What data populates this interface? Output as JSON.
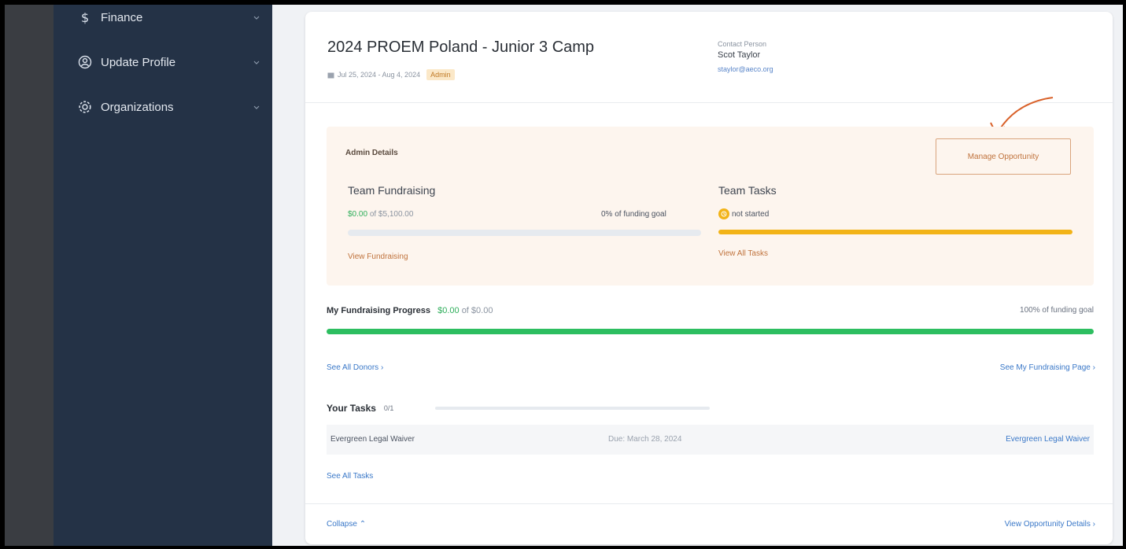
{
  "sidebar": {
    "items": [
      {
        "icon": "dollar-icon",
        "label": "Finance"
      },
      {
        "icon": "user-circle-icon",
        "label": "Update Profile"
      },
      {
        "icon": "gear-icon",
        "label": "Organizations"
      }
    ]
  },
  "opportunity": {
    "title": "2024 PROEM Poland - Junior 3 Camp",
    "dates": "Jul 25, 2024 - Aug 4, 2024",
    "badge": "Admin",
    "contact_label": "Contact Person",
    "contact_name": "Scot Taylor",
    "contact_email": "staylor@aeco.org"
  },
  "admin": {
    "title": "Admin Details",
    "manage_button": "Manage Opportunity",
    "team_fundraising": {
      "title": "Team Fundraising",
      "raised": "$0.00",
      "of_text": "of $5,100.00",
      "pct_text": "0% of funding goal",
      "progress": 0,
      "link": "View Fundraising"
    },
    "team_tasks": {
      "title": "Team Tasks",
      "status": "not started",
      "link": "View All Tasks"
    }
  },
  "my_fundraising": {
    "title": "My Fundraising Progress",
    "raised": "$0.00",
    "of_text": "of $0.00",
    "pct_text": "100% of funding goal",
    "progress": 100,
    "donors_link": "See All Donors",
    "page_link": "See My Fundraising Page"
  },
  "tasks": {
    "title": "Your Tasks",
    "count": "0/1",
    "rows": [
      {
        "name": "Evergreen Legal Waiver",
        "due": "Due: March 28, 2024",
        "link": "Evergreen Legal Waiver"
      }
    ],
    "see_all": "See All Tasks"
  },
  "footer": {
    "collapse": "Collapse",
    "details": "View Opportunity Details"
  },
  "colors": {
    "sidebar": "#243246",
    "accent_orange": "#c0733d",
    "progress_green": "#2dbe60",
    "status_yellow": "#f2b317",
    "link_blue": "#3a78c8"
  }
}
